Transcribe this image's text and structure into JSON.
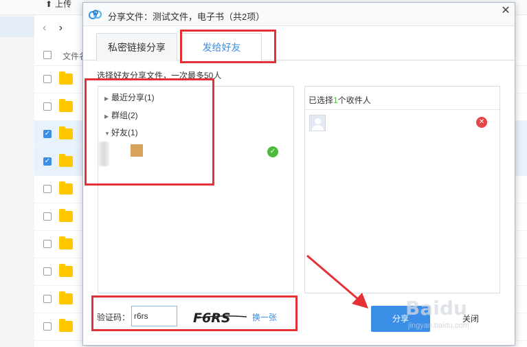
{
  "background": {
    "upload_label": "上传",
    "nav_back": "‹",
    "nav_forward": "›",
    "header_label": "文件名",
    "rows": [
      {
        "checked": false
      },
      {
        "checked": false
      },
      {
        "checked": true
      },
      {
        "checked": true
      },
      {
        "checked": false
      },
      {
        "checked": false
      },
      {
        "checked": false
      },
      {
        "checked": false
      },
      {
        "checked": false
      },
      {
        "checked": false
      }
    ]
  },
  "dialog": {
    "title": "分享文件：测试文件，电子书（共2项）",
    "close_glyph": "✕",
    "tabs": [
      {
        "label": "私密链接分享",
        "active": false
      },
      {
        "label": "发给好友",
        "active": true
      }
    ],
    "hint": "选择好友分享文件，一次最多50人",
    "tree": [
      {
        "label": "最近分享(1)",
        "expanded": false,
        "arrow": "▶"
      },
      {
        "label": "群组(2)",
        "expanded": false,
        "arrow": "▶"
      },
      {
        "label": "好友(1)",
        "expanded": true,
        "arrow": "▼"
      }
    ],
    "selected_header": {
      "prefix": "已选择",
      "count": "1",
      "suffix": "个收件人"
    },
    "captcha": {
      "label": "验证码：",
      "value": "r6rs",
      "image_text": "F6RS",
      "change_label": "换一张"
    },
    "share_button": "分享",
    "close_button": "关闭"
  },
  "watermark": {
    "text": "Baidu",
    "sub": "jingyan.baidu.com"
  },
  "colors": {
    "accent": "#3a8ee6",
    "annotation_red": "#e53035",
    "check_green": "#4cba3b",
    "remove_red": "#e6454a",
    "folder_yellow": "#ffc700"
  }
}
